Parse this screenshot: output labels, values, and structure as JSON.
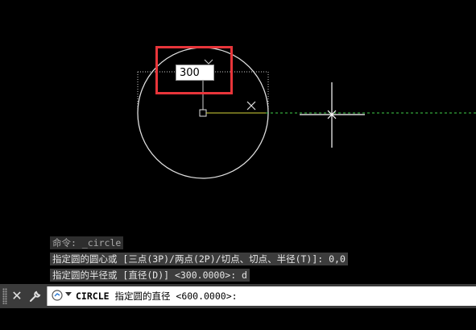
{
  "drawing": {
    "dimension_value": "300"
  },
  "command_history": [
    "命令: _circle",
    "指定圆的圆心或 [三点(3P)/两点(2P)/切点、切点、半径(T)]: 0,0",
    "指定圆的半径或 [直径(D)] <300.0000>: d"
  ],
  "command_line": {
    "command": "CIRCLE",
    "prompt": " 指定圆的直径 <600.0000>:"
  },
  "toolbar": {
    "close_glyph": "✕",
    "customize_glyph": "🔧"
  },
  "colors": {
    "background": "#000000",
    "circle": "#e0e0e0",
    "highlight": "#e8353a",
    "tracking_line": "#3fd04a",
    "rubberband": "#d6d63a"
  }
}
